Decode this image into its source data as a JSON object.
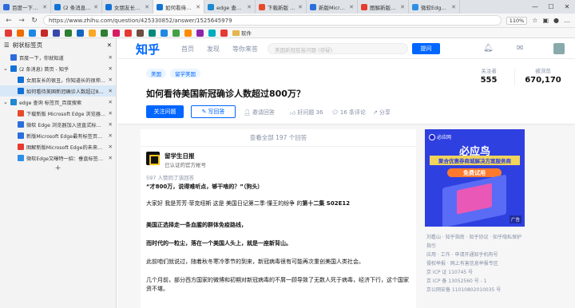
{
  "tabs": [
    {
      "label": "百度一下，你就",
      "color": "#2d6bdc"
    },
    {
      "label": "(2 条消息) 首页",
      "color": "#1372d6"
    },
    {
      "label": "女朋友长的很丑",
      "color": "#1372d6"
    },
    {
      "label": "如何看待美国新冠",
      "color": "#1372d6",
      "active": true
    },
    {
      "label": "edge 查询 标签页",
      "color": "#1e88d0"
    },
    {
      "label": "下载新版 Microsoft",
      "color": "#e74a2b"
    },
    {
      "label": "新版Microsoft",
      "color": "#2a6fdb"
    },
    {
      "label": "图解新版Microsoft",
      "color": "#e63b2e"
    },
    {
      "label": "微软Edge又惊",
      "color": "#2f8fe8"
    }
  ],
  "address": {
    "url": "https://www.zhihu.com/question/425330852/answer/1525645979",
    "zoom": "110%"
  },
  "favorites": {
    "folder_label": "软件",
    "colors": [
      "#e53935",
      "#ef6c00",
      "#1e88e5",
      "#c62828",
      "#3949ab",
      "#2e7d32",
      "#1565c0",
      "#f9a825",
      "#2e7d32",
      "#d81b60",
      "#e53935",
      "#6d4c41",
      "#00897b",
      "#1e88e5",
      "#43a047",
      "#fb8c00",
      "#8e24aa",
      "#00acc1",
      "#e53935"
    ]
  },
  "sidebar": {
    "title": "树状标签页",
    "rows": [
      {
        "label": "百度一下，你就知道",
        "color": "#2d6bdc",
        "indent": 0
      },
      {
        "label": "(2 条消息) 首页 - 知乎",
        "color": "#1372d6",
        "indent": 0,
        "caret": "⌄"
      },
      {
        "label": "女朋友长的很丑，你知道长的很帅怎么办？知乎",
        "color": "#1372d6",
        "indent": 1
      },
      {
        "label": "如何看待美国新冠确诊人数超过800万？",
        "color": "#1372d6",
        "indent": 1,
        "selected": true
      },
      {
        "label": "edge 查询 标签页_百度搜索",
        "color": "#1e88d0",
        "indent": 0,
        "caret": "⌄"
      },
      {
        "label": "下载新版 Microsoft Edge 浏览器 | Micro",
        "color": "#e74a2b",
        "indent": 1
      },
      {
        "label": "微软 Edge 浏览器加入竖直式标签栏和",
        "color": "#2a6fdb",
        "indent": 1
      },
      {
        "label": "新版Microsoft Edge最有标签页功能属",
        "color": "#2a6fdb",
        "indent": 1
      },
      {
        "label": "图解新版Microsoft Edge的未来新功能、",
        "color": "#e63b2e",
        "indent": 1
      },
      {
        "label": "微软Edge又曝特一招：垂直标签页、一键",
        "color": "#2f8fe8",
        "indent": 1
      }
    ]
  },
  "zhihu": {
    "logo": "知乎",
    "nav": [
      "首页",
      "发现",
      "等你来答"
    ],
    "search_placeholder": "美国新冠疫苗问题 (存疑)",
    "ask_label": "提问",
    "topics": [
      "美国",
      "留学美国"
    ],
    "question_title": "如何看待美国新冠确诊人数超过800万？",
    "followers_label": "关注者",
    "followers": "555",
    "views_label": "被浏览",
    "views": "670,170",
    "follow_btn": "关注问题",
    "write_btn": "写回答",
    "invite": "邀请回答",
    "good_question": "好问题 36",
    "comments": "16 条评论",
    "share": "分享",
    "view_all": "查看全部 197 个回答",
    "author_name": "留学生日报",
    "author_sub": "已认证的官方帐号",
    "agreed": "597 人赞同了该回答",
    "quote": "“才800万，说得难听点，够干啥的？”（狗头）",
    "p1a": "大家好 我是芳芳·菲克纽斯 这是 美国日记第二季·懂王的纷争 的",
    "p1b": "第十二集 S02E12",
    "b1": "美国正选择走一条血腥的群体免疫路线，",
    "b2": "而时代的一粒尘，落在一个美国人头上，就是一座新背山。",
    "p2": "此前咱们就说过，随着秋冬寒冷季节的到来，新冠病毒很有可能再次重创美国人类社会。",
    "p3": "几个月前，部分西方国家的微博和初期对新冠病毒的不屑一顾导致了无数人死于病毒，经济下行，这个国家资不堪。",
    "ad": {
      "brand": "必应网",
      "title": "必应鸟",
      "band": "聚合优惠券商城解决方案服务商",
      "button": "免费试用",
      "tag": "广告"
    },
    "footer": [
      "刘看山 · 知乎指南 · 知乎协议 · 知乎隐私保护指引",
      "应用 · 工作 · 申请开通知乎机构号",
      "侵权举报 · 网上有害信息举报专区",
      "京 ICP 证 110745 号",
      "京 ICP 备 13052560 号 - 1",
      "京公网安备 11010802010035 号"
    ]
  }
}
